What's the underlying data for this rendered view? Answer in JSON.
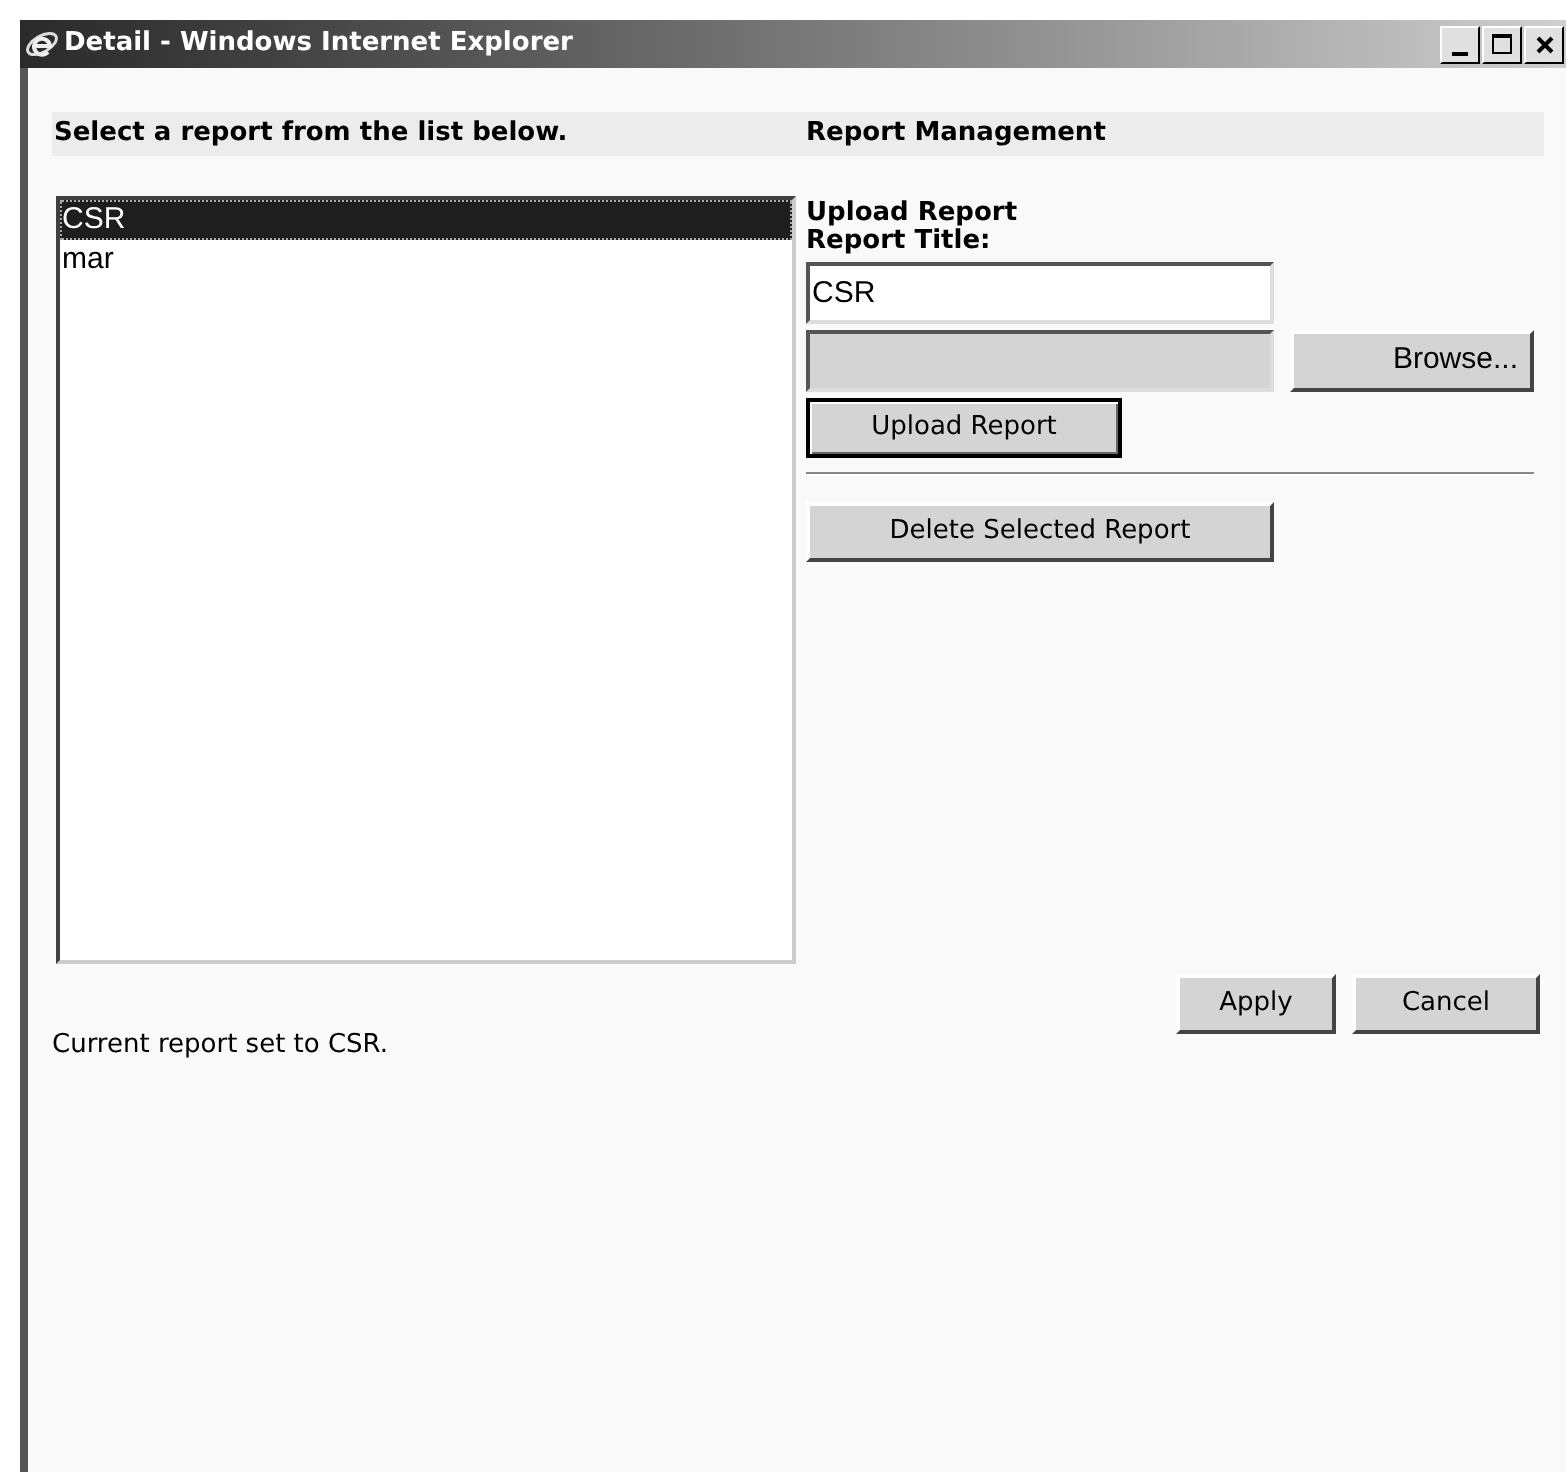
{
  "window": {
    "title": "Detail - Windows Internet Explorer"
  },
  "left_heading": "Select a report from the list below.",
  "right_heading": "Report Management",
  "reports": [
    {
      "label": "CSR",
      "selected": true
    },
    {
      "label": "mar",
      "selected": false
    }
  ],
  "upload": {
    "heading": "Upload Report",
    "title_label": "Report Title:",
    "title_value": "CSR",
    "browse": "Browse...",
    "upload_button": "Upload Report"
  },
  "delete_button": "Delete Selected Report",
  "apply": "Apply",
  "cancel": "Cancel",
  "status": "Current report set to CSR."
}
